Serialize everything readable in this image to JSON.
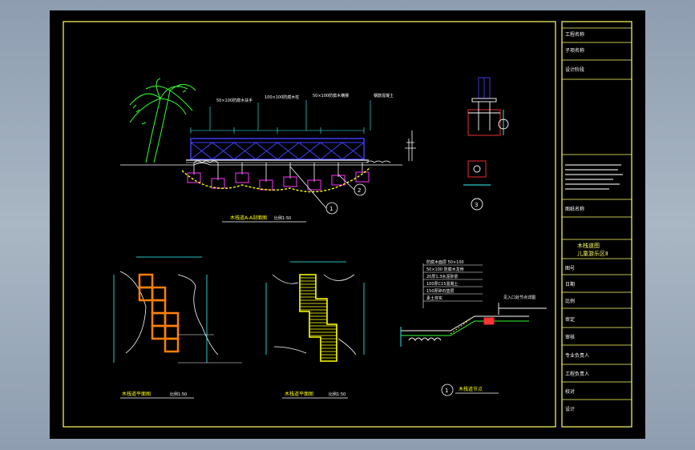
{
  "drawing": {
    "elevation_caption": "木栈道A-A剖面图",
    "elevation_scale": "比例1:50",
    "plan1_caption": "木栈道平面图",
    "plan1_scale": "比例1:50",
    "plan2_caption": "木栈道平面图",
    "plan2_scale": "比例1:50",
    "section_caption": "木栈道节点",
    "section_marker": "1",
    "detail_marker_a": "1",
    "detail_marker_b": "2",
    "detail_marker_c": "3",
    "layer_notes": [
      "防腐木面层 50×100",
      "50×100 防腐木龙骨",
      "20厚1:3水泥砂浆",
      "100厚C15混凝土",
      "150厚碎石垫层",
      "素土夯实"
    ],
    "callouts": [
      "50×100防腐木扶手",
      "100×100防腐木柱",
      "50×100防腐木横撑",
      "钢筋混凝土"
    ],
    "slope_note": "见入口处节点详图"
  },
  "title_block": {
    "rows": [
      "工程名称",
      "子项名称",
      "设计阶段",
      "",
      "",
      "图纸名称",
      "木栈道图",
      "儿童游乐区Ⅱ",
      "图号",
      "日期",
      "比例",
      "审定",
      "审核",
      "专业负责人",
      "工程负责人",
      "校对",
      "设计"
    ],
    "project_title_line1": "木栈道图",
    "project_title_line2": "儿童游乐区Ⅱ"
  },
  "colors": {
    "frame": "#ffff66",
    "line_white": "#ffffff",
    "line_green": "#33ff33",
    "line_cyan": "#33ffff",
    "line_blue": "#4040ff",
    "line_red": "#ff3333",
    "line_orange": "#ff8000",
    "line_magenta": "#ff33ff",
    "hatch_yellow": "#ffff00"
  }
}
